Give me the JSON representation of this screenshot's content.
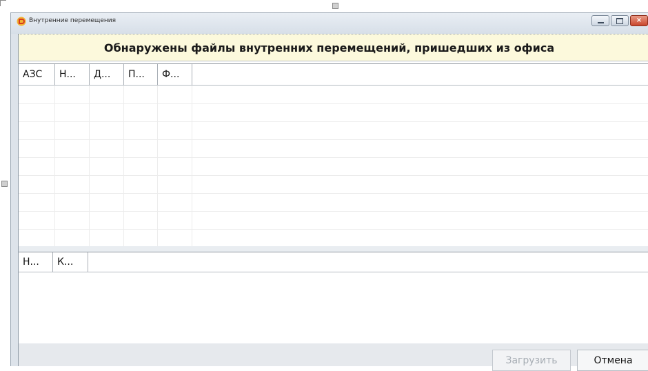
{
  "window": {
    "title": "Внутренние перемещения",
    "controls": [
      "minimize",
      "maximize",
      "close"
    ]
  },
  "banner": {
    "text": "Обнаружены файлы внутренних перемещений, пришедших из офиса"
  },
  "files_table": {
    "columns": [
      "АЗС",
      "Н...",
      "Д...",
      "П...",
      "Ф..."
    ],
    "rows": []
  },
  "details_table": {
    "columns": [
      "Н...",
      "К..."
    ],
    "rows": []
  },
  "buttons": {
    "load_label": "Загрузить",
    "load_enabled": false,
    "cancel_label": "Отмена"
  },
  "colors": {
    "banner_bg": "#fcf9dc",
    "disabled_text": "#a7adb4"
  },
  "icons": {
    "app": "app-logo-icon"
  }
}
